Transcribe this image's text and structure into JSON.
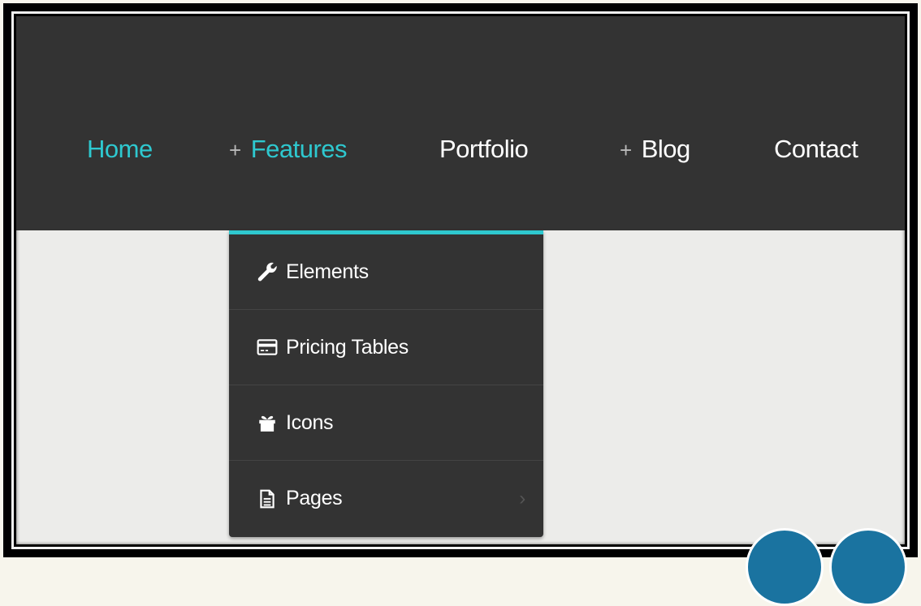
{
  "nav": {
    "items": [
      {
        "label": "Home",
        "plus": ""
      },
      {
        "label": "Features",
        "plus": "+"
      },
      {
        "label": "Portfolio",
        "plus": ""
      },
      {
        "label": "Blog",
        "plus": "+"
      },
      {
        "label": "Contact",
        "plus": ""
      }
    ],
    "active": [
      "Home",
      "Features"
    ]
  },
  "dropdown": {
    "items": [
      {
        "label": "Elements",
        "icon": "wrench-icon"
      },
      {
        "label": "Pricing Tables",
        "icon": "credit-card-icon"
      },
      {
        "label": "Icons",
        "icon": "gift-icon"
      },
      {
        "label": "Pages",
        "icon": "document-icon",
        "submenu_indicator": "›"
      }
    ]
  },
  "colors": {
    "navbar": "#333333",
    "accent": "#2ec8cf",
    "content_bg": "#ececea",
    "dropdown_bg": "#333333"
  }
}
